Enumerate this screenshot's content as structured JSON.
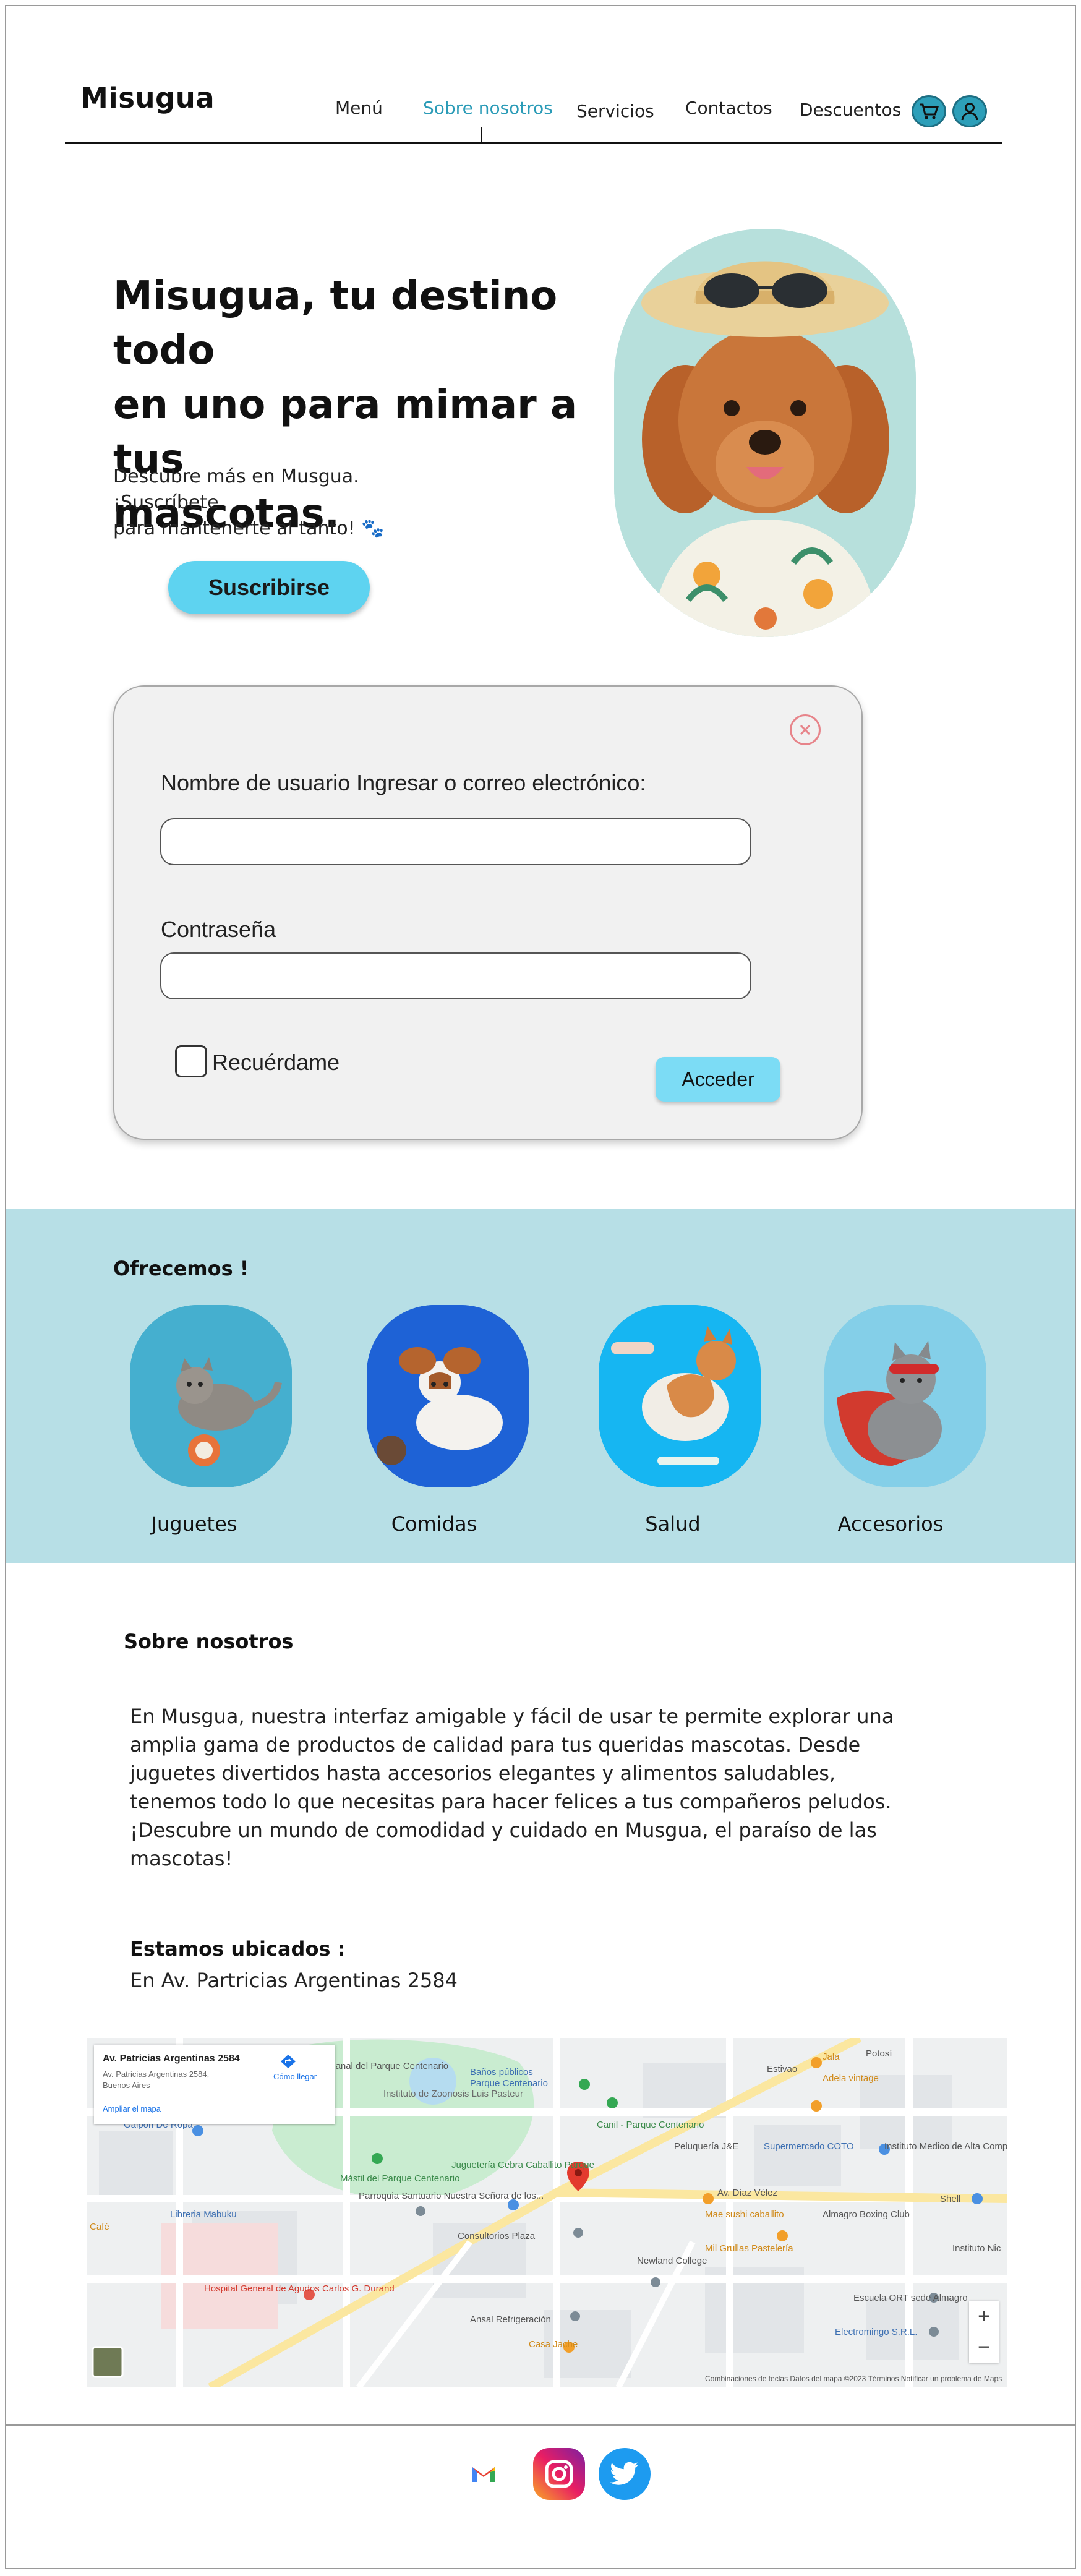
{
  "header": {
    "logo": "Misugua",
    "nav": [
      "Menú",
      "Sobre nosotros",
      "Servicios",
      "Contactos",
      "Descuentos"
    ],
    "active_nav": "Sobre nosotros",
    "accent_color": "#2a9bb7"
  },
  "hero": {
    "title_line1": "Misugua, tu destino todo",
    "title_line2": "en uno para mimar a tus",
    "title_line3": "mascotas.",
    "subtitle_line1": "Descubre más en Musgua. ¡Suscríbete",
    "subtitle_line2": "para mantenerte al tanto! 🐾",
    "subscribe_label": "Suscribirse",
    "button_color": "#5ed3f0"
  },
  "login": {
    "username_label": "Nombre de usuario Ingresar o correo electrónico:",
    "password_label": "Contraseña",
    "remember_label": "Recuérdame",
    "submit_label": "Acceder",
    "username_value": "",
    "password_value": ""
  },
  "offer": {
    "title": "Ofrecemos  !",
    "items": [
      "Juguetes",
      "Comidas",
      "Salud",
      "Accesorios"
    ],
    "band_color": "#b7dfe6"
  },
  "about": {
    "title": "Sobre nosotros",
    "text": "En Musgua, nuestra interfaz amigable y fácil de usar te permite explorar una amplia gama de productos de calidad para tus queridas mascotas. Desde juguetes divertidos hasta accesorios elegantes y alimentos saludables, tenemos todo lo que necesitas para hacer felices a tus compañeros peludos. ¡Descubre un mundo de comodidad y cuidado en Musgua, el paraíso de las mascotas!",
    "location_title": "Estamos ubicados :",
    "location_address": "En Av. Partricias Argentinas 2584"
  },
  "map": {
    "card_title": "Av. Patricias Argentinas 2584",
    "card_line1": "Av. Patricias Argentinas 2584,",
    "card_line2": "Buenos Aires",
    "card_link": "Ampliar el mapa",
    "directions": "Cómo llegar",
    "labels": [
      "Baños públicos",
      "Parque Centenario",
      "Instituto de Zoonosis Luis Pasteur",
      "Galpón De Ropa",
      "Juguetería Cebra Caballito Parque",
      "Parroquia Santuario Nuestra Señora de los...",
      "Consultorios Plaza",
      "Canil - Parque Centenario",
      "Peluquería J&E",
      "Supermercado COTO",
      "Instituto Medico de Alta Complejidad IMAC",
      "Av. Díaz Vélez",
      "Mae sushi caballito",
      "Mil Grullas Pastelería",
      "Almagro Boxing Club",
      "Newland College",
      "Libreria Mabuku",
      "Hospital General de Agudos Carlos G. Durand",
      "Ansal Refrigeración",
      "Casa Jache",
      "Escuela ORT sede Almagro",
      "Electromingo S.R.L.",
      "Adela vintage",
      "Jala",
      "Estivao",
      "Potosí",
      "Shell",
      "Instituto Nic",
      "Café",
      "Mástil del Parque Centenario",
      "Feria Artesanal del Parque Centenario"
    ],
    "attribution": "Combinaciones de teclas   Datos del mapa ©2023   Términos   Notificar un problema de Maps",
    "zoom_in": "+",
    "zoom_out": "−"
  },
  "footer": {
    "icons": [
      "gmail-icon",
      "instagram-icon",
      "twitter-icon"
    ]
  }
}
